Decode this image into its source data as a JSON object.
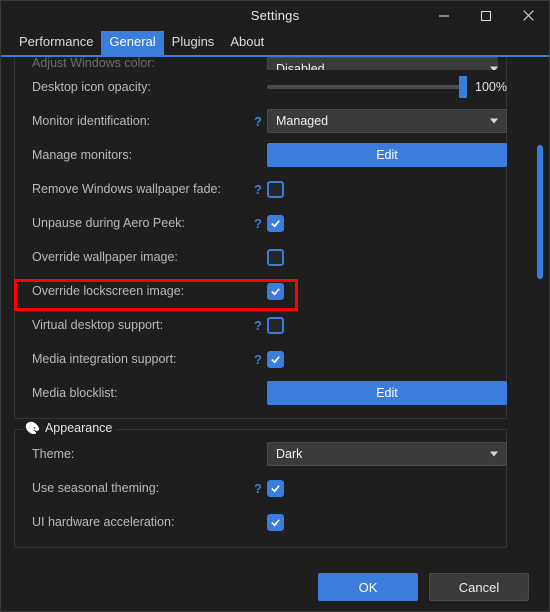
{
  "window": {
    "title": "Settings",
    "controls": [
      {
        "name": "minimize",
        "glyph": "minimize-icon"
      },
      {
        "name": "maximize",
        "glyph": "maximize-icon"
      },
      {
        "name": "close",
        "glyph": "close-icon"
      }
    ]
  },
  "tabs": [
    {
      "label": "Performance",
      "active": false
    },
    {
      "label": "General",
      "active": true
    },
    {
      "label": "Plugins",
      "active": false
    },
    {
      "label": "About",
      "active": false
    }
  ],
  "rows": {
    "clipped": {
      "label": "Adjust Windows color:",
      "value": "Disabled"
    },
    "desktop_icon_opacity": {
      "label": "Desktop icon opacity:",
      "value": "100%"
    },
    "monitor_identification": {
      "label": "Monitor identification:",
      "value": "Managed",
      "help": "?"
    },
    "manage_monitors": {
      "label": "Manage monitors:",
      "button": "Edit"
    },
    "remove_wallpaper_fade": {
      "label": "Remove Windows wallpaper fade:",
      "help": "?",
      "checked": "false"
    },
    "unpause_aero_peek": {
      "label": "Unpause during Aero Peek:",
      "help": "?",
      "checked": "true"
    },
    "override_wallpaper": {
      "label": "Override wallpaper image:",
      "help": "",
      "checked": "false"
    },
    "override_lockscreen": {
      "label": "Override lockscreen image:",
      "help": "",
      "checked": "true"
    },
    "virtual_desktop": {
      "label": "Virtual desktop support:",
      "help": "?",
      "checked": "false"
    },
    "media_integration": {
      "label": "Media integration support:",
      "help": "?",
      "checked": "true"
    },
    "media_blocklist": {
      "label": "Media blocklist:",
      "button": "Edit"
    }
  },
  "appearance": {
    "group_title": "Appearance",
    "group_icon": "palette-icon",
    "theme": {
      "label": "Theme:",
      "value": "Dark"
    },
    "seasonal_theming": {
      "label": "Use seasonal theming:",
      "help": "?",
      "checked": "true"
    },
    "ui_hardware_acceleration": {
      "label": "UI hardware acceleration:",
      "help": "",
      "checked": "true"
    }
  },
  "footer": {
    "ok": "OK",
    "cancel": "Cancel"
  },
  "colors": {
    "accent": "#3b7ddd",
    "window_bg": "#1e1e1e",
    "highlight": "#ff0000",
    "control_bg": "#3b3b3b"
  }
}
